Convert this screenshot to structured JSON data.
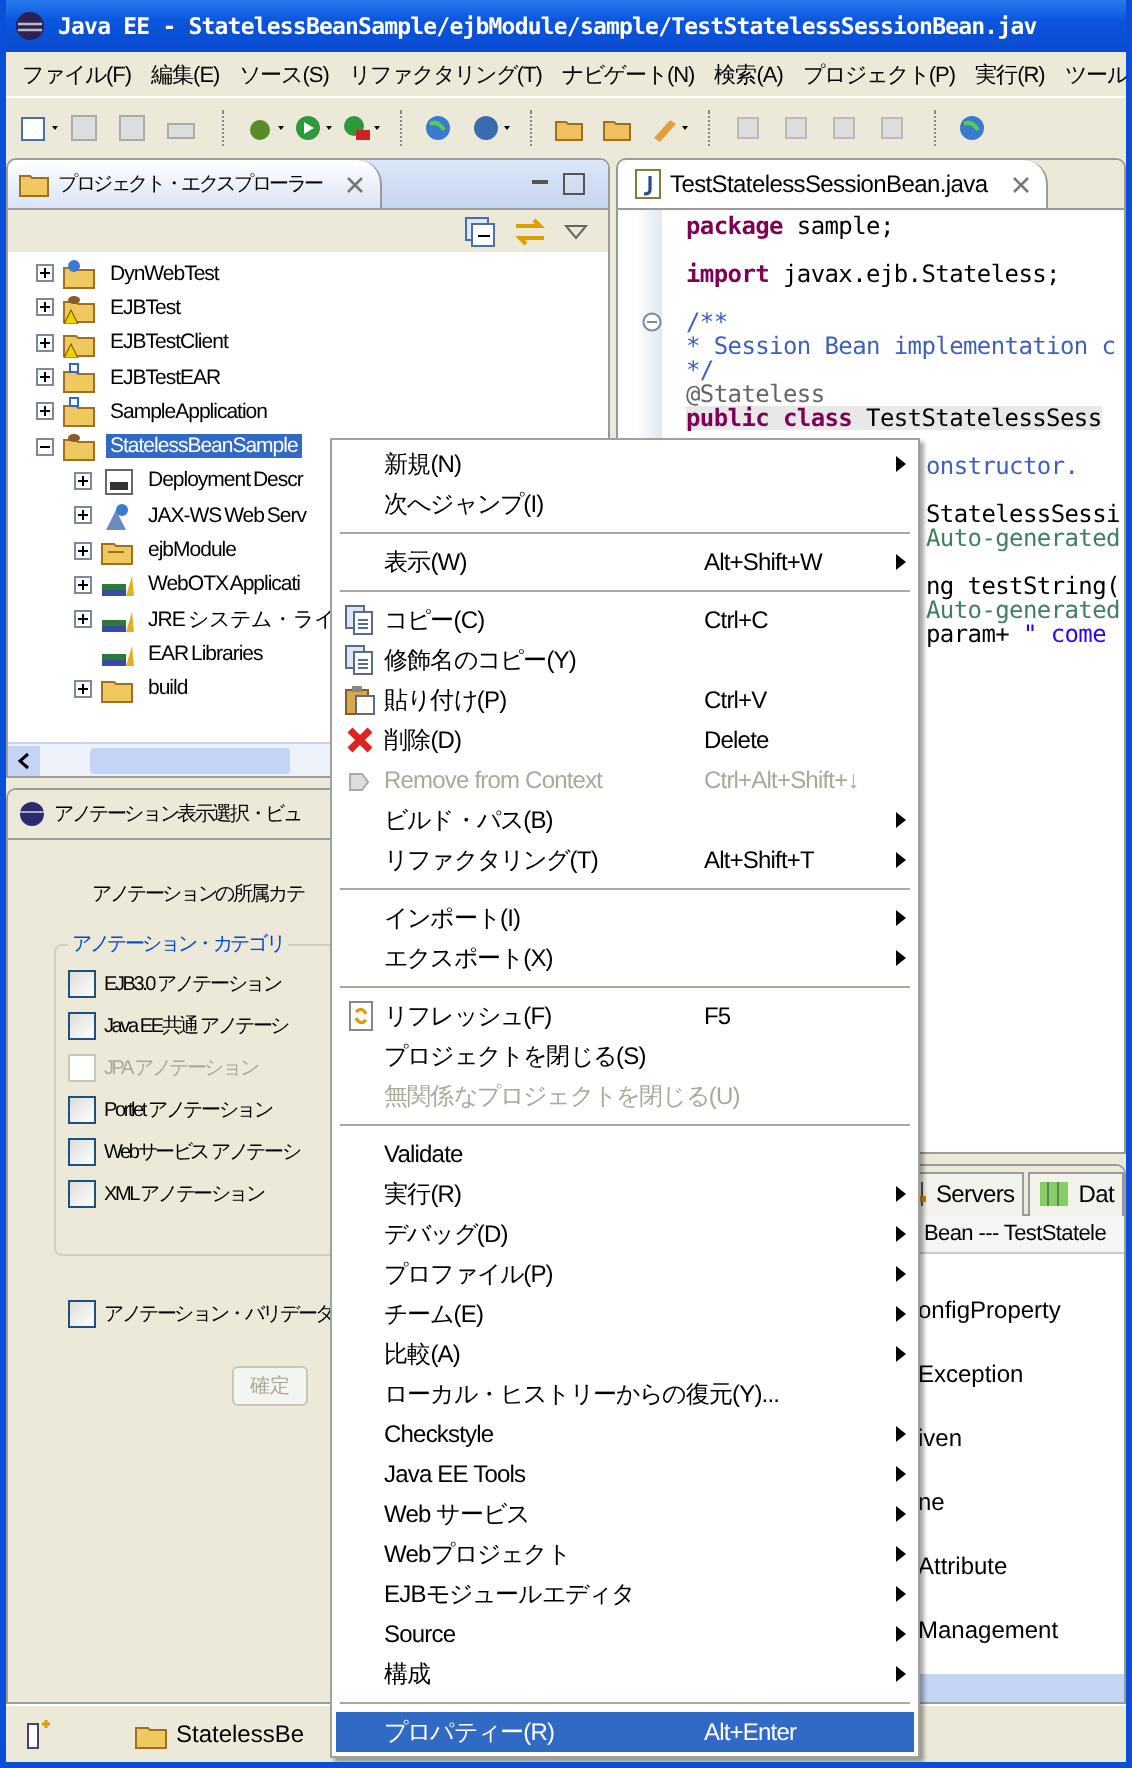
{
  "window": {
    "title": "Java EE - StatelessBeanSample/ejbModule/sample/TestStatelessSessionBean.jav"
  },
  "menu_bar": [
    "ファイル(F)",
    "編集(E)",
    "ソース(S)",
    "リファクタリング(T)",
    "ナビゲート(N)",
    "検索(A)",
    "プロジェクト(P)",
    "実行(R)",
    "ツール"
  ],
  "explorer": {
    "title": "プロジェクト・エクスプローラー",
    "tree": [
      {
        "label": "DynWebTest",
        "kind": "web_project",
        "warning": false,
        "expandable": true,
        "expanded": false,
        "selected": false
      },
      {
        "label": "EJBTest",
        "kind": "ejb_project",
        "warning": true,
        "expandable": true,
        "expanded": false,
        "selected": false
      },
      {
        "label": "EJBTestClient",
        "kind": "plain_project",
        "warning": true,
        "expandable": true,
        "expanded": false,
        "selected": false
      },
      {
        "label": "EJBTestEAR",
        "kind": "ear_project",
        "warning": false,
        "expandable": true,
        "expanded": false,
        "selected": false
      },
      {
        "label": "SampleApplication",
        "kind": "ear_project",
        "warning": false,
        "expandable": true,
        "expanded": false,
        "selected": false
      },
      {
        "label": "StatelessBeanSample",
        "kind": "ejb_project",
        "warning": false,
        "expandable": true,
        "expanded": true,
        "selected": true,
        "children": [
          {
            "label": "Deployment Descr",
            "kind": "descriptor",
            "expandable": true,
            "expanded": false,
            "selected": false
          },
          {
            "label": "JAX-WS Web Serv",
            "kind": "webservice",
            "expandable": true,
            "expanded": false,
            "selected": false
          },
          {
            "label": "ejbModule",
            "kind": "source_folder",
            "expandable": true,
            "expanded": false,
            "selected": false
          },
          {
            "label": "WebOTX Applicati",
            "kind": "library",
            "expandable": true,
            "expanded": false,
            "selected": false
          },
          {
            "label": "JRE システム・ライ",
            "kind": "library",
            "expandable": true,
            "expanded": false,
            "selected": false
          },
          {
            "label": "EAR Libraries",
            "kind": "library",
            "expandable": false,
            "expanded": false,
            "selected": false
          },
          {
            "label": "build",
            "kind": "folder",
            "expandable": true,
            "expanded": false,
            "selected": false
          }
        ]
      }
    ]
  },
  "annotation_view": {
    "title": "アノテーション表示選択・ビュ",
    "intro": "アノテーションの所属カテ",
    "group_title": "アノテーション・カテゴリ",
    "categories": [
      {
        "label": "EJB3.0 アノテーション",
        "checked": false,
        "disabled": false
      },
      {
        "label": "Java EE共通 アノテーシ",
        "checked": false,
        "disabled": false
      },
      {
        "label": "JPA アノテーション",
        "checked": false,
        "disabled": true
      },
      {
        "label": "Portlet アノテーション",
        "checked": false,
        "disabled": false
      },
      {
        "label": "Webサービス アノテーシ",
        "checked": false,
        "disabled": false
      },
      {
        "label": "XML アノテーション",
        "checked": false,
        "disabled": false
      }
    ],
    "validator": {
      "label": "アノテーション・バリデータ",
      "checked": false
    },
    "buttons": [
      {
        "label": "確定",
        "disabled": true
      }
    ]
  },
  "editor": {
    "tab": "TestStatelessSessionBean.java",
    "blocks": [
      [
        {
          "current": false,
          "parts": [
            {
              "kind": "keyword",
              "text": "package"
            },
            {
              "kind": "plain",
              "text": " sample;"
            }
          ]
        }
      ],
      [
        {
          "current": false,
          "parts": [
            {
              "kind": "keyword",
              "text": "import"
            },
            {
              "kind": "plain",
              "text": " javax.ejb.Stateless;"
            }
          ]
        }
      ],
      [
        {
          "current": false,
          "parts": [
            {
              "kind": "javadoc",
              "text": "/**"
            }
          ]
        },
        {
          "current": false,
          "parts": [
            {
              "kind": "javadoc",
              "text": " * Session Bean implementation c"
            }
          ]
        },
        {
          "current": false,
          "parts": [
            {
              "kind": "javadoc",
              "text": " */"
            }
          ]
        },
        {
          "current": false,
          "parts": [
            {
              "kind": "annotation",
              "text": "@Stateless"
            }
          ]
        },
        {
          "current": true,
          "parts": [
            {
              "kind": "keyword",
              "text": "public class"
            },
            {
              "kind": "plain",
              "text": " TestStatelessSess"
            }
          ]
        }
      ]
    ],
    "fragments_beside_menu": [
      [
        {
          "parts": [
            {
              "kind": "javadoc",
              "text": "onstructor."
            }
          ]
        }
      ],
      [
        {
          "parts": [
            {
              "kind": "plain",
              "text": "StatelessSessi"
            }
          ]
        },
        {
          "parts": [
            {
              "kind": "comment",
              "text": "Auto-generated"
            }
          ]
        }
      ],
      [
        {
          "parts": [
            {
              "kind": "plain",
              "text": "ng testString("
            }
          ]
        },
        {
          "parts": [
            {
              "kind": "comment",
              "text": "Auto-generated"
            }
          ]
        },
        {
          "parts": [
            {
              "kind": "plain",
              "text": "param+ "
            },
            {
              "kind": "string",
              "text": "\" come"
            }
          ]
        }
      ]
    ]
  },
  "bottom_panel": {
    "tabs": [
      {
        "label": "Servers",
        "selected": false
      },
      {
        "label": "Dat",
        "selected": false
      }
    ],
    "header": "Bean --- TestStatele",
    "items": [
      "onfigProperty",
      "Exception",
      "iven",
      "ne",
      "Attribute",
      "Management"
    ]
  },
  "context_menu": [
    {
      "kind": "item",
      "label": "新規(N)",
      "submenu": true,
      "disabled": false,
      "selected": false
    },
    {
      "kind": "item",
      "label": "次へジャンプ(I)",
      "submenu": false,
      "disabled": false,
      "selected": false
    },
    {
      "kind": "separator"
    },
    {
      "kind": "item",
      "label": "表示(W)",
      "shortcut": "Alt+Shift+W",
      "submenu": true,
      "disabled": false,
      "selected": false
    },
    {
      "kind": "separator"
    },
    {
      "kind": "item",
      "label": "コピー(C)",
      "shortcut": "Ctrl+C",
      "submenu": false,
      "disabled": false,
      "selected": false
    },
    {
      "kind": "item",
      "label": "修飾名のコピー(Y)",
      "submenu": false,
      "disabled": false,
      "selected": false
    },
    {
      "kind": "item",
      "label": "貼り付け(P)",
      "shortcut": "Ctrl+V",
      "submenu": false,
      "disabled": false,
      "selected": false
    },
    {
      "kind": "item",
      "label": "削除(D)",
      "shortcut": "Delete",
      "submenu": false,
      "disabled": false,
      "selected": false
    },
    {
      "kind": "item",
      "label": "Remove from Context",
      "shortcut": "Ctrl+Alt+Shift+↓",
      "submenu": false,
      "disabled": true,
      "selected": false
    },
    {
      "kind": "item",
      "label": "ビルド・パス(B)",
      "submenu": true,
      "disabled": false,
      "selected": false
    },
    {
      "kind": "item",
      "label": "リファクタリング(T)",
      "shortcut": "Alt+Shift+T",
      "submenu": true,
      "disabled": false,
      "selected": false
    },
    {
      "kind": "separator"
    },
    {
      "kind": "item",
      "label": "インポート(I)",
      "submenu": true,
      "disabled": false,
      "selected": false
    },
    {
      "kind": "item",
      "label": "エクスポート(X)",
      "submenu": true,
      "disabled": false,
      "selected": false
    },
    {
      "kind": "separator"
    },
    {
      "kind": "item",
      "label": "リフレッシュ(F)",
      "shortcut": "F5",
      "submenu": false,
      "disabled": false,
      "selected": false
    },
    {
      "kind": "item",
      "label": "プロジェクトを閉じる(S)",
      "submenu": false,
      "disabled": false,
      "selected": false
    },
    {
      "kind": "item",
      "label": "無関係なプロジェクトを閉じる(U)",
      "submenu": false,
      "disabled": true,
      "selected": false
    },
    {
      "kind": "separator"
    },
    {
      "kind": "item",
      "label": "Validate",
      "submenu": false,
      "disabled": false,
      "selected": false
    },
    {
      "kind": "item",
      "label": "実行(R)",
      "submenu": true,
      "disabled": false,
      "selected": false
    },
    {
      "kind": "item",
      "label": "デバッグ(D)",
      "submenu": true,
      "disabled": false,
      "selected": false
    },
    {
      "kind": "item",
      "label": "プロファイル(P)",
      "submenu": true,
      "disabled": false,
      "selected": false
    },
    {
      "kind": "item",
      "label": "チーム(E)",
      "submenu": true,
      "disabled": false,
      "selected": false
    },
    {
      "kind": "item",
      "label": "比較(A)",
      "submenu": true,
      "disabled": false,
      "selected": false
    },
    {
      "kind": "item",
      "label": "ローカル・ヒストリーからの復元(Y)...",
      "submenu": false,
      "disabled": false,
      "selected": false
    },
    {
      "kind": "item",
      "label": "Checkstyle",
      "submenu": true,
      "disabled": false,
      "selected": false
    },
    {
      "kind": "item",
      "label": "Java EE Tools",
      "submenu": true,
      "disabled": false,
      "selected": false
    },
    {
      "kind": "item",
      "label": "Web サービス",
      "submenu": true,
      "disabled": false,
      "selected": false
    },
    {
      "kind": "item",
      "label": "Webプロジェクト",
      "submenu": true,
      "disabled": false,
      "selected": false
    },
    {
      "kind": "item",
      "label": "EJBモジュールエディタ",
      "submenu": true,
      "disabled": false,
      "selected": false
    },
    {
      "kind": "item",
      "label": "Source",
      "submenu": true,
      "disabled": false,
      "selected": false
    },
    {
      "kind": "item",
      "label": "構成",
      "submenu": true,
      "disabled": false,
      "selected": false
    },
    {
      "kind": "separator"
    },
    {
      "kind": "item",
      "label": "プロパティー(R)",
      "shortcut": "Alt+Enter",
      "submenu": false,
      "disabled": false,
      "selected": true
    }
  ],
  "status_bar": {
    "text": "StatelessBe"
  }
}
